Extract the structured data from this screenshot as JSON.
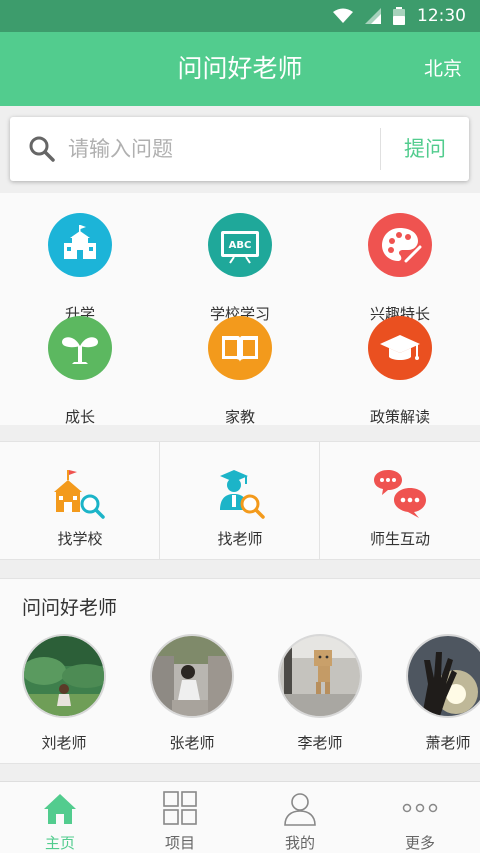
{
  "status_bar": {
    "time": "12:30"
  },
  "header": {
    "title": "问问好老师",
    "city": "北京"
  },
  "search": {
    "placeholder": "请输入问题",
    "value": "",
    "ask_label": "提问"
  },
  "categories": [
    {
      "label": "升学",
      "icon": "school-building-icon",
      "color": "#1cb4d8"
    },
    {
      "label": "学校学习",
      "icon": "blackboard-abc-icon",
      "color": "#1fa89a"
    },
    {
      "label": "兴趣特长",
      "icon": "palette-icon",
      "color": "#ef5350"
    },
    {
      "label": "成长",
      "icon": "sprout-icon",
      "color": "#5cb860"
    },
    {
      "label": "家教",
      "icon": "open-book-icon",
      "color": "#f39a1c"
    },
    {
      "label": "政策解读",
      "icon": "graduation-cap-icon",
      "color": "#ea5020"
    }
  ],
  "quick_actions": [
    {
      "label": "找学校",
      "icon": "find-school-icon"
    },
    {
      "label": "找老师",
      "icon": "find-teacher-icon"
    },
    {
      "label": "师生互动",
      "icon": "chat-bubbles-icon"
    }
  ],
  "teachers_section": {
    "title": "问问好老师",
    "teachers": [
      {
        "name": "刘老师"
      },
      {
        "name": "张老师"
      },
      {
        "name": "李老师"
      },
      {
        "name": "萧老师"
      }
    ]
  },
  "bottom_nav": [
    {
      "label": "主页",
      "icon": "home-icon",
      "active": true
    },
    {
      "label": "项目",
      "icon": "grid-icon",
      "active": false
    },
    {
      "label": "我的",
      "icon": "user-icon",
      "active": false
    },
    {
      "label": "更多",
      "icon": "more-dots-icon",
      "active": false
    }
  ],
  "colors": {
    "primary": "#52cc8e",
    "status_bar": "#3d9c6c",
    "quick_orange": "#f39a1c",
    "quick_teal": "#1cb4c8",
    "quick_red": "#ef5350"
  }
}
